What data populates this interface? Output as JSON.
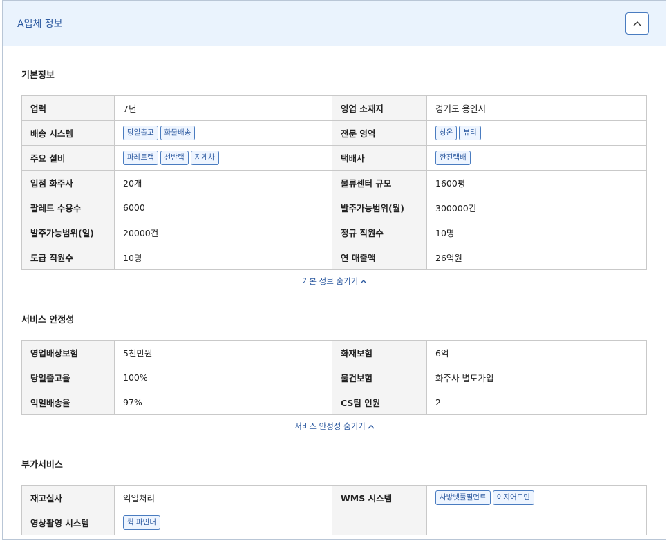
{
  "panel": {
    "title": "A업체 정보",
    "collapse_icon": "chevron-up-icon"
  },
  "basic": {
    "title": "기본정보",
    "hide_label": "기본 정보 숨기기",
    "rows": [
      {
        "l1": "업력",
        "v1": "7년",
        "l2": "영업 소재지",
        "v2": "경기도 용인시"
      },
      {
        "l1": "배송 시스템",
        "tags1": [
          "당일출고",
          "화물배송"
        ],
        "l2": "전문 영역",
        "tags2": [
          "상온",
          "뷰티"
        ]
      },
      {
        "l1": "주요 설비",
        "tags1": [
          "파레트랙",
          "선반랙",
          "지게차"
        ],
        "l2": "택배사",
        "tags2": [
          "한진택배"
        ]
      },
      {
        "l1": "입점 화주사",
        "v1": "20개",
        "l2": "물류센터 규모",
        "v2": "1600평"
      },
      {
        "l1": "팔레트 수용수",
        "v1": "6000",
        "l2": "발주가능범위(월)",
        "v2": "300000건"
      },
      {
        "l1": "발주가능범위(일)",
        "v1": "20000건",
        "l2": "정규 직원수",
        "v2": "10명"
      },
      {
        "l1": "도급 직원수",
        "v1": "10명",
        "l2": "연 매출액",
        "v2": "26억원"
      }
    ]
  },
  "service": {
    "title": "서비스 안정성",
    "hide_label": "서비스 안정성 숨기기",
    "rows": [
      {
        "l1": "영업배상보험",
        "v1": "5천만원",
        "l2": "화재보험",
        "v2": "6억"
      },
      {
        "l1": "당일출고율",
        "v1": "100%",
        "l2": "물건보험",
        "v2": "화주사 별도가입"
      },
      {
        "l1": "익일배송율",
        "v1": "97%",
        "l2": "CS팀 인원",
        "v2": "2"
      }
    ]
  },
  "extra": {
    "title": "부가서비스",
    "rows": [
      {
        "l1": "재고실사",
        "v1": "익일처리",
        "l2": "WMS 시스템",
        "tags2": [
          "사방넷풀필먼트",
          "이지어드민"
        ]
      },
      {
        "l1": "영상촬영 시스템",
        "tags1": [
          "퀵 파인더"
        ],
        "l2": "",
        "v2": ""
      }
    ]
  },
  "colors": {
    "accent": "#2d5aa0",
    "header_bg": "#eaf3fd",
    "label_bg": "#f4f4f4",
    "border": "#c9c9c9"
  }
}
